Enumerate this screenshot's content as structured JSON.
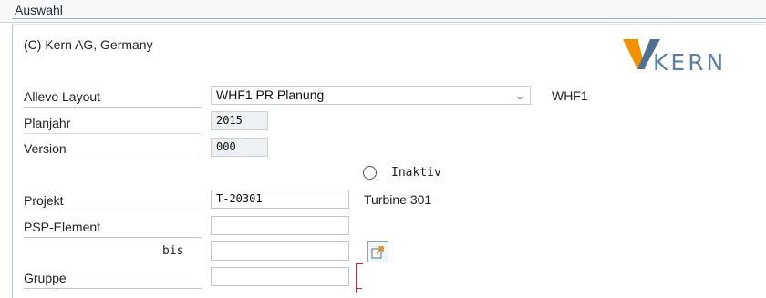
{
  "header": {
    "title": "Auswahl"
  },
  "copyright": "(C) Kern AG, Germany",
  "logo": {
    "text": "KERN",
    "colors": {
      "orange": "#f39200",
      "blue": "#4f6f93"
    }
  },
  "fields": {
    "layout": {
      "label": "Allevo Layout",
      "value": "WHF1 PR Planung",
      "code": "WHF1"
    },
    "planjahr": {
      "label": "Planjahr",
      "value": "2015"
    },
    "version": {
      "label": "Version",
      "value": "000"
    },
    "inaktiv": {
      "label": "Inaktiv",
      "checked": false
    },
    "projekt": {
      "label": "Projekt",
      "value": "T-20301",
      "description": "Turbine 301"
    },
    "psp": {
      "label": "PSP-Element",
      "value": "",
      "to_label": "bis",
      "to_value": ""
    },
    "gruppe": {
      "label": "Gruppe",
      "value": ""
    }
  },
  "icons": {
    "dropdown": "chevron-down-icon",
    "multiple_selection": "multiple-selection-icon"
  }
}
